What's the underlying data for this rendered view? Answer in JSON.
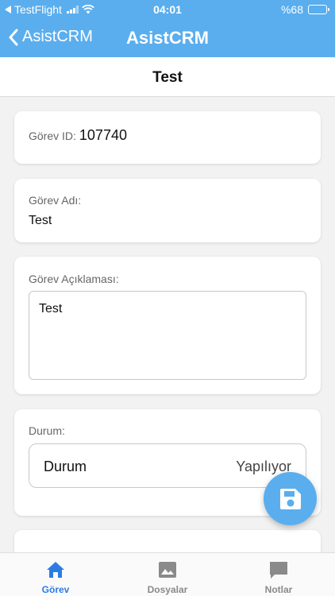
{
  "status_bar": {
    "back_app": "TestFlight",
    "time": "04:01",
    "battery": "%68",
    "battery_level": 0.68
  },
  "nav": {
    "back_label": "AsistCRM",
    "title": "AsistCRM"
  },
  "page": {
    "title": "Test"
  },
  "task": {
    "id_label": "Görev ID:",
    "id_value": "107740",
    "name_label": "Görev Adı:",
    "name_value": "Test",
    "description_label": "Görev Açıklaması:",
    "description_value": "Test",
    "status_label": "Durum:",
    "status_field": "Durum",
    "status_value": "Yapılıyor"
  },
  "tabs": [
    {
      "label": "Görev",
      "icon": "home-icon",
      "active": true
    },
    {
      "label": "Dosyalar",
      "icon": "image-icon",
      "active": false
    },
    {
      "label": "Notlar",
      "icon": "comment-icon",
      "active": false
    }
  ],
  "colors": {
    "accent": "#5aaeee",
    "tab_active": "#2c7be5",
    "tab_inactive": "#8a8a8a"
  },
  "fab": {
    "icon": "save-icon"
  }
}
